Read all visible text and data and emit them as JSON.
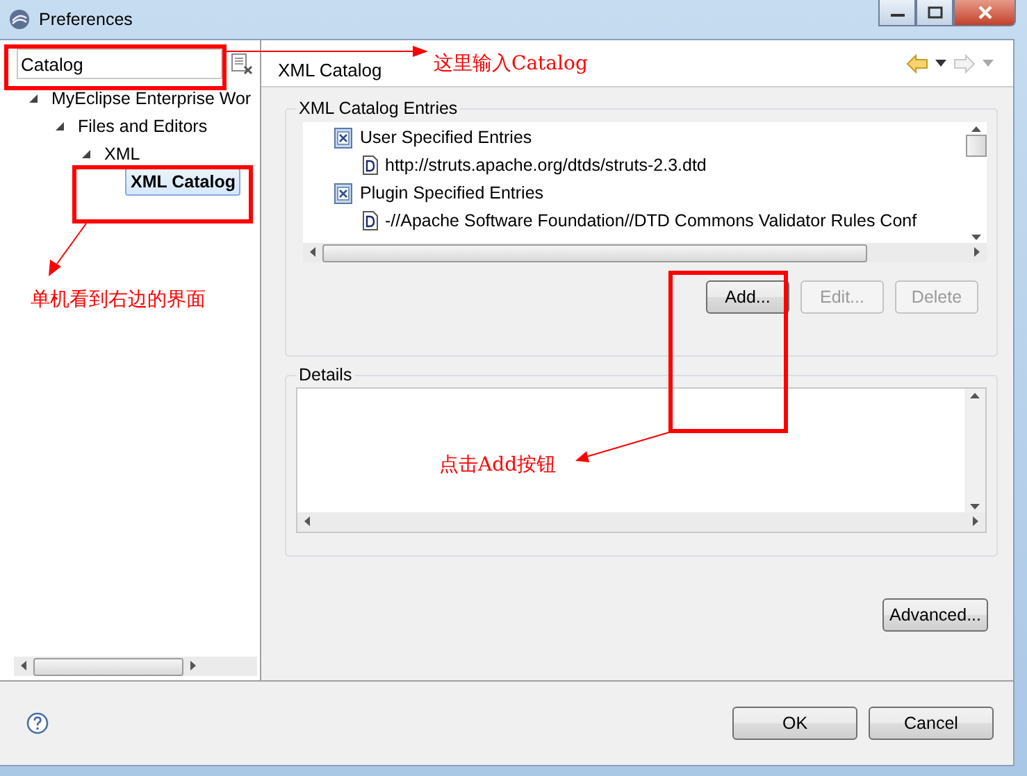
{
  "window": {
    "title": "Preferences"
  },
  "filter": {
    "value": "Catalog"
  },
  "tree": [
    {
      "label": "MyEclipse Enterprise Wor",
      "expanded": true,
      "selected": false,
      "children": [
        {
          "label": "Files and Editors",
          "expanded": true,
          "selected": false,
          "children": [
            {
              "label": "XML",
              "expanded": true,
              "selected": false,
              "children": [
                {
                  "label": "XML Catalog",
                  "selected": true
                }
              ]
            }
          ]
        }
      ]
    }
  ],
  "page": {
    "title": "XML Catalog"
  },
  "entries": {
    "title": "XML Catalog Entries",
    "items": [
      {
        "kind": "group",
        "label": "User Specified Entries"
      },
      {
        "kind": "item",
        "label": "http://struts.apache.org/dtds/struts-2.3.dtd"
      },
      {
        "kind": "group",
        "label": "Plugin Specified Entries"
      },
      {
        "kind": "item",
        "label": "-//Apache Software Foundation//DTD Commons Validator Rules Conf"
      }
    ],
    "buttons": [
      {
        "label": "Add...",
        "disabled": false
      },
      {
        "label": "Edit...",
        "disabled": true
      },
      {
        "label": "Delete",
        "disabled": true
      }
    ]
  },
  "details": {
    "title": "Details"
  },
  "advanced_button": "Advanced...",
  "footer_buttons": [
    "OK",
    "Cancel"
  ],
  "annotations": [
    {
      "text": "这里输入Catalog"
    },
    {
      "text": "单机看到右边的界面"
    },
    {
      "text": "点击Add按钮"
    }
  ]
}
